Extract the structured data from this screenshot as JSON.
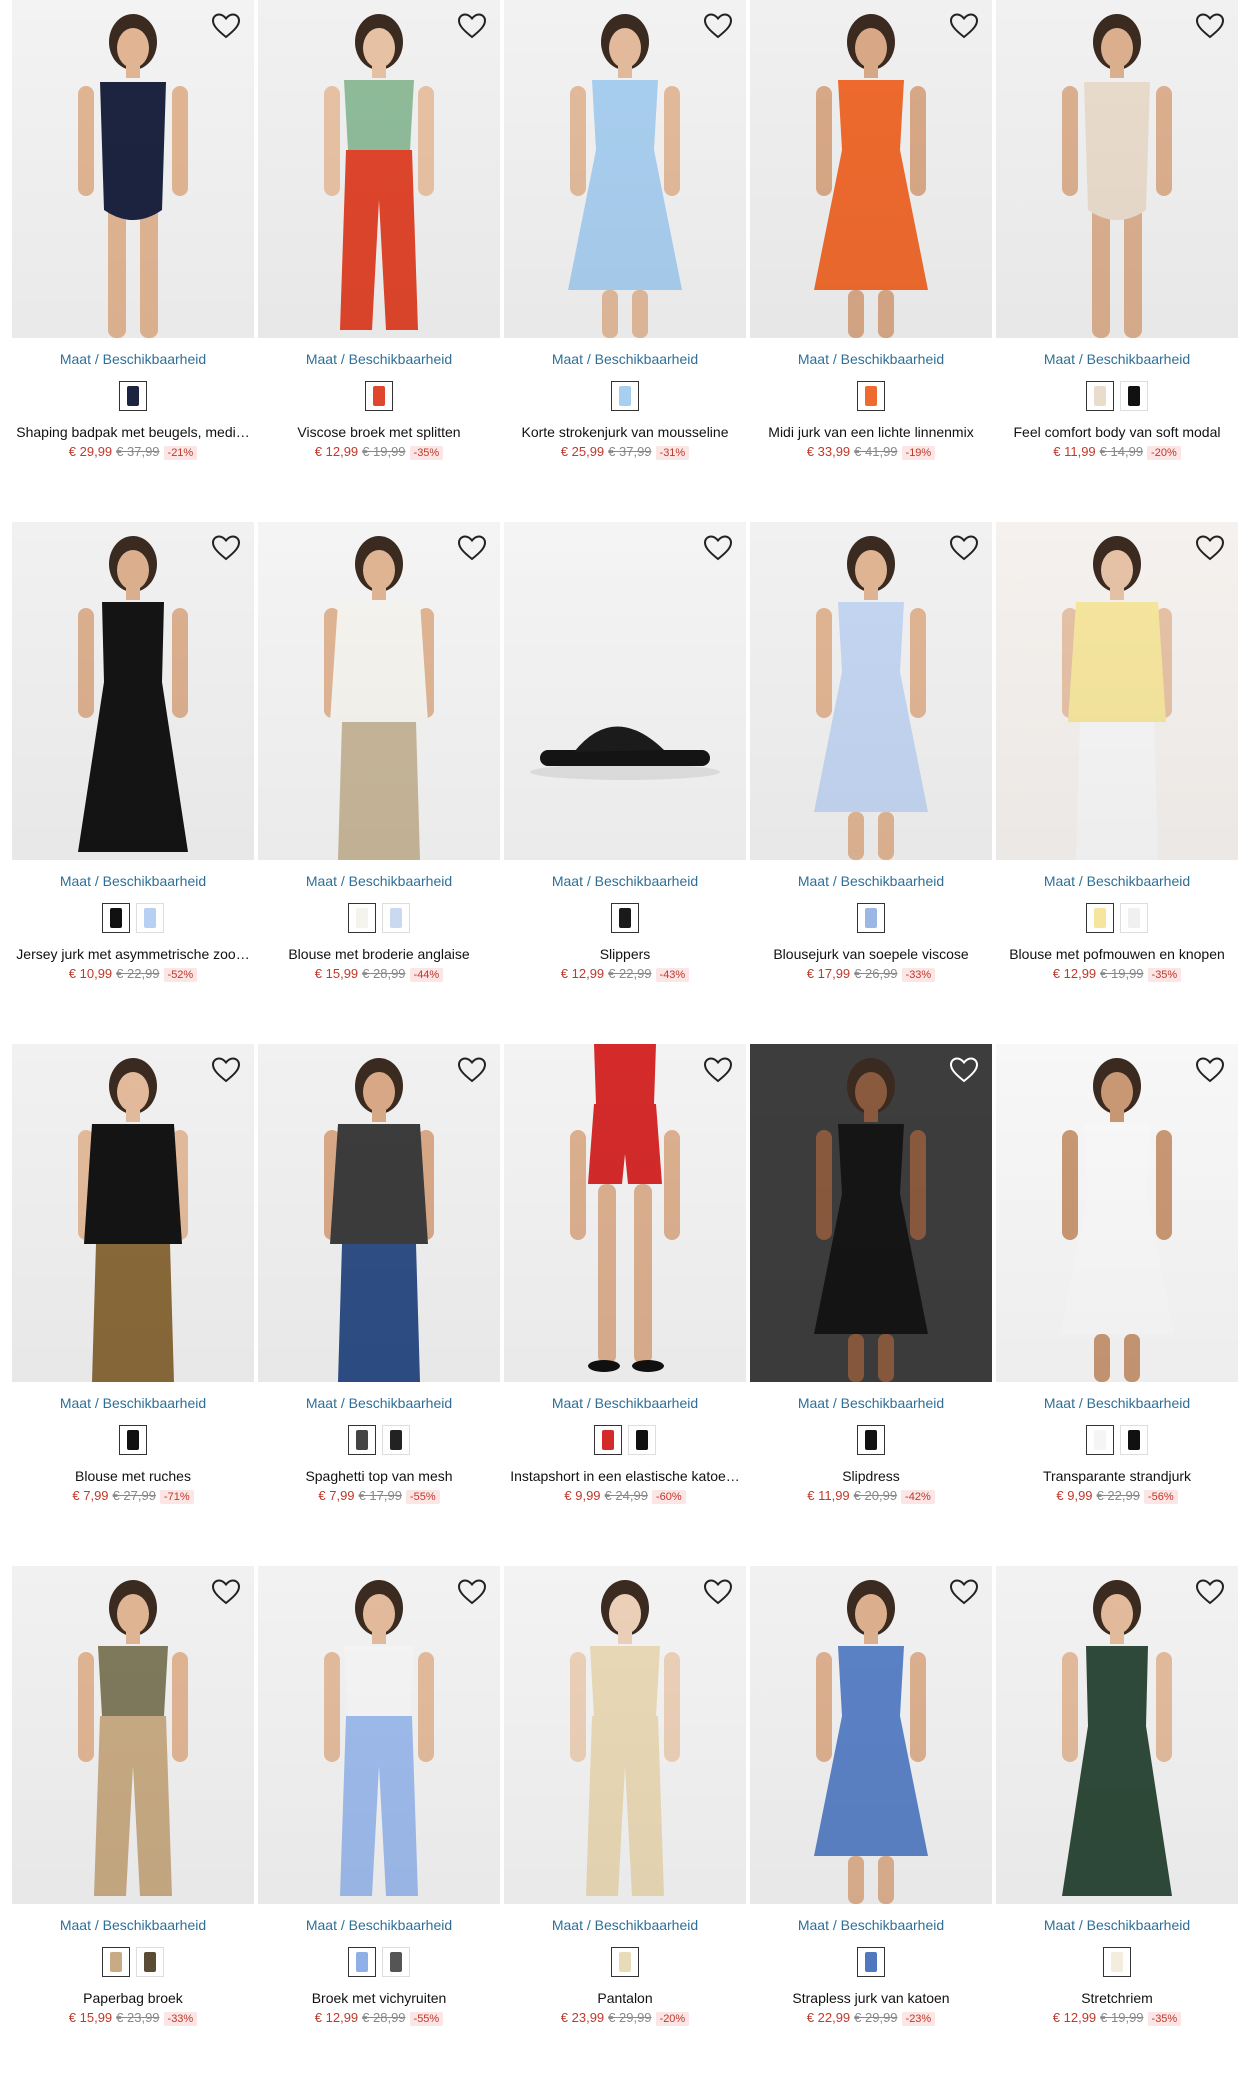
{
  "size_link_label": "Maat / Beschikbaarheid",
  "colors": {
    "link": "#2f6f97",
    "price": "#c0392b",
    "discount_bg": "#fbe5e5"
  },
  "products": [
    {
      "title": "Shaping badpak met beugels, medi…",
      "price": "€ 29,99",
      "old_price": "€ 37,99",
      "discount": "-21%",
      "swatches": [
        "#1d2440"
      ],
      "photo": {
        "bg": "#f3f3f3",
        "garment": "#1d2440",
        "shape": "swimsuit",
        "skin": "#e2b694"
      }
    },
    {
      "title": "Viscose broek met splitten",
      "price": "€ 12,99",
      "old_price": "€ 19,99",
      "discount": "-35%",
      "swatches": [
        "#e0462c"
      ],
      "photo": {
        "bg": "#f1f1f1",
        "garment": "#e0462c",
        "shape": "pants",
        "skin": "#e8c2a4",
        "top": "#8fbc9a"
      }
    },
    {
      "title": "Korte strokenjurk van mousseline",
      "price": "€ 25,99",
      "old_price": "€ 37,99",
      "discount": "-31%",
      "swatches": [
        "#a9cff0"
      ],
      "photo": {
        "bg": "#f2f2f2",
        "garment": "#a9cff0",
        "shape": "dress",
        "skin": "#e3bb9c"
      }
    },
    {
      "title": "Midi jurk van een lichte linnenmix",
      "price": "€ 33,99",
      "old_price": "€ 41,99",
      "discount": "-19%",
      "swatches": [
        "#ef6a2e"
      ],
      "photo": {
        "bg": "#f0f0f0",
        "garment": "#ef6a2e",
        "shape": "dress",
        "skin": "#d9a987"
      }
    },
    {
      "title": "Feel comfort body van soft modal",
      "price": "€ 11,99",
      "old_price": "€ 14,99",
      "discount": "-20%",
      "swatches": [
        "#eadccd",
        "#111111"
      ],
      "photo": {
        "bg": "#f1f1f1",
        "garment": "#eadccd",
        "shape": "body",
        "skin": "#dcb08f"
      }
    },
    {
      "title": "Jersey jurk met asymmetrische zoo…",
      "price": "€ 10,99",
      "old_price": "€ 22,99",
      "discount": "-52%",
      "swatches": [
        "#111111",
        "#b7cff2"
      ],
      "photo": {
        "bg": "#f1f1f1",
        "garment": "#141414",
        "shape": "longdress",
        "skin": "#dcb08f"
      }
    },
    {
      "title": "Blouse met broderie anglaise",
      "price": "€ 15,99",
      "old_price": "€ 28,99",
      "discount": "-44%",
      "swatches": [
        "#f5f3ee",
        "#c9d9ef"
      ],
      "photo": {
        "bg": "#f4f4f4",
        "garment": "#f6f4ef",
        "shape": "blouse",
        "skin": "#e0b594",
        "bottom": "#c8b79a"
      }
    },
    {
      "title": "Slippers",
      "price": "€ 12,99",
      "old_price": "€ 22,99",
      "discount": "-43%",
      "swatches": [
        "#1a1a1a"
      ],
      "photo": {
        "bg": "#f4f4f4",
        "garment": "#1a1a1a",
        "shape": "slipper",
        "skin": "#000"
      }
    },
    {
      "title": "Blousejurk van soepele viscose",
      "price": "€ 17,99",
      "old_price": "€ 26,99",
      "discount": "-33%",
      "swatches": [
        "#9ab7e6"
      ],
      "photo": {
        "bg": "#f1f1f1",
        "garment": "#c4d6f2",
        "shape": "dress",
        "skin": "#e0b594"
      }
    },
    {
      "title": "Blouse met pofmouwen en knopen",
      "price": "€ 12,99",
      "old_price": "€ 19,99",
      "discount": "-35%",
      "swatches": [
        "#f6e59c",
        "#f0f0f0"
      ],
      "photo": {
        "bg": "#f5f1ee",
        "garment": "#f6e69e",
        "shape": "blouse",
        "skin": "#e6c2a6",
        "bottom": "#f7f7f7"
      }
    },
    {
      "title": "Blouse met ruches",
      "price": "€ 7,99",
      "old_price": "€ 27,99",
      "discount": "-71%",
      "swatches": [
        "#111111"
      ],
      "photo": {
        "bg": "#f1f1f1",
        "garment": "#141414",
        "shape": "blouse",
        "skin": "#e3bb9c",
        "bottom": "#8a6a3a"
      }
    },
    {
      "title": "Spaghetti top van mesh",
      "price": "€ 7,99",
      "old_price": "€ 17,99",
      "discount": "-55%",
      "swatches": [
        "#444444",
        "#222222"
      ],
      "photo": {
        "bg": "#f1f1f1",
        "garment": "#3c3c3c",
        "shape": "blouse",
        "skin": "#d9a987",
        "bottom": "#2e4f86"
      }
    },
    {
      "title": "Instapshort in een elastische katoe…",
      "price": "€ 9,99",
      "old_price": "€ 24,99",
      "discount": "-60%",
      "swatches": [
        "#d42a2a",
        "#111111"
      ],
      "photo": {
        "bg": "#f3f3f3",
        "garment": "#d42a2a",
        "shape": "shorts",
        "skin": "#dcb08f"
      }
    },
    {
      "title": "Slipdress",
      "price": "€ 11,99",
      "old_price": "€ 20,99",
      "discount": "-42%",
      "swatches": [
        "#111111"
      ],
      "photo": {
        "bg": "#3d3d3d",
        "garment": "#151515",
        "shape": "dress",
        "skin": "#8a5a3e"
      }
    },
    {
      "title": "Transparante strandjurk",
      "price": "€ 9,99",
      "old_price": "€ 22,99",
      "discount": "-56%",
      "swatches": [
        "#f5f5f5",
        "#111111"
      ],
      "photo": {
        "bg": "#f7f7f7",
        "garment": "#f9f9f9",
        "shape": "dress",
        "skin": "#c99874"
      }
    },
    {
      "title": "Paperbag broek",
      "price": "€ 15,99",
      "old_price": "€ 23,99",
      "discount": "-33%",
      "swatches": [
        "#c8ab84",
        "#5a4b34"
      ],
      "photo": {
        "bg": "#f1f1f1",
        "garment": "#c8ab84",
        "shape": "pants",
        "skin": "#e0b594",
        "top": "#7f7a5c"
      }
    },
    {
      "title": "Broek met vichyruiten",
      "price": "€ 12,99",
      "old_price": "€ 28,99",
      "discount": "-55%",
      "swatches": [
        "#8fb0e6",
        "#555555"
      ],
      "photo": {
        "bg": "#f2f2f2",
        "garment": "#9dbbec",
        "shape": "pants",
        "skin": "#e3bb9c",
        "top": "#f5f5f5"
      }
    },
    {
      "title": "Pantalon",
      "price": "€ 23,99",
      "old_price": "€ 29,99",
      "discount": "-20%",
      "swatches": [
        "#e8dbb8"
      ],
      "photo": {
        "bg": "#f3f3f3",
        "garment": "#ead9b6",
        "shape": "pants",
        "skin": "#ecd0b8",
        "top": "#ead9b6"
      }
    },
    {
      "title": "Strapless jurk van katoen",
      "price": "€ 22,99",
      "old_price": "€ 29,99",
      "discount": "-23%",
      "swatches": [
        "#4f78c0"
      ],
      "photo": {
        "bg": "#f1f1f1",
        "garment": "#5b82c6",
        "shape": "dress",
        "skin": "#dcb08f"
      }
    },
    {
      "title": "Stretchriem",
      "price": "€ 12,99",
      "old_price": "€ 19,99",
      "discount": "-35%",
      "swatches": [
        "#f4ecdc"
      ],
      "photo": {
        "bg": "#f2f2f2",
        "garment": "#2f4a3a",
        "shape": "longdress",
        "skin": "#e3bb9c"
      }
    }
  ]
}
